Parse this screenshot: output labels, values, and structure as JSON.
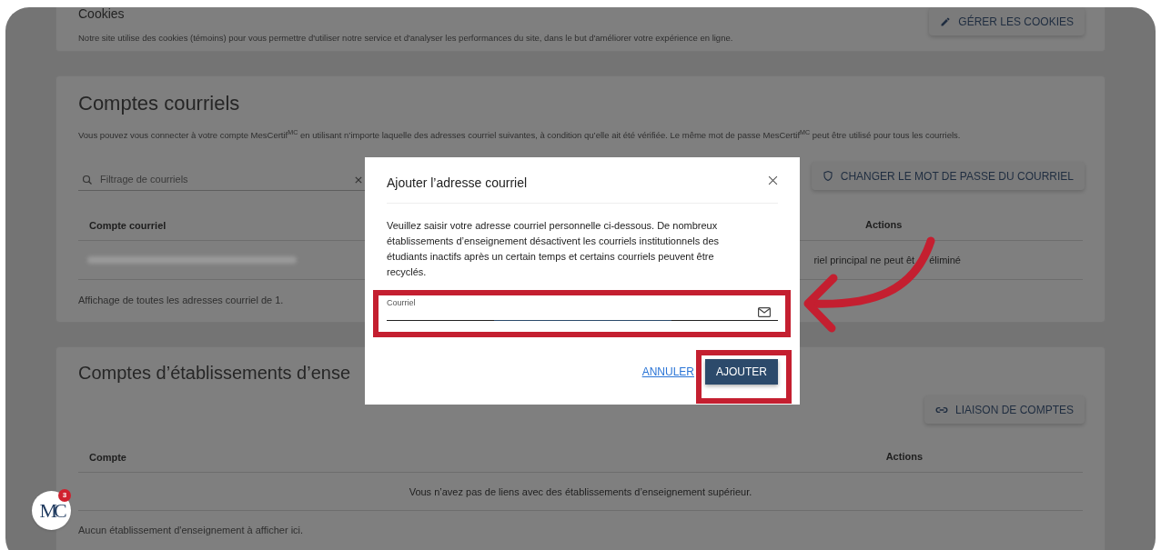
{
  "cookies": {
    "title": "Cookies",
    "description": "Notre site utilise des cookies (témoins) pour vous permettre d'utiliser notre service et d'analyser les performances du site, dans le but d'améliorer votre expérience en ligne.",
    "button": "GÉRER LES COOKIES"
  },
  "email_accounts": {
    "title": "Comptes courriels",
    "description": "Vous pouvez vous connecter à votre compte MesCertif$^{MC}$ en utilisant n’importe laquelle des adresses courriel suivantes, à condition qu’elle ait été vérifiée. Le même mot de passe MesCertif$^{MC}$ peut être utilisé pour tous les courriels.",
    "filter": {
      "placeholder": "Filtrage de courriels"
    },
    "button": "CHANGER LE MOT DE PASSE DU COURRIEL",
    "table": {
      "columns": [
        "Compte courriel",
        "Actions"
      ],
      "rows": [
        {
          "action_note": [
            "riel principal ne peut êt",
            "éliminé"
          ]
        }
      ]
    },
    "footer": "Affichage de toutes les adresses courriel de 1."
  },
  "institution_accounts": {
    "title": "Comptes d’établissements d’ense",
    "button": "LIAISON DE COMPTES",
    "table": {
      "columns": [
        "Compte",
        "Actions"
      ],
      "empty_message": "Vous n’avez pas de liens avec des établissements d’enseignement supérieur."
    },
    "footer": "Aucun établissement d'enseignement à afficher ici."
  },
  "dialog": {
    "title": "Ajouter l’adresse courriel",
    "message": "Veuillez saisir votre adresse courriel personnelle ci-dessous. De nombreux établissements d’enseignement désactivent les courriels institutionnels des étudiants inactifs après un certain temps et certains courriels peuvent être recyclés.",
    "field": {
      "label": "Courriel"
    },
    "buttons": [
      {
        "label": "ANNULER",
        "kind": "link"
      },
      {
        "label": "AJOUTER",
        "kind": "primary"
      }
    ]
  },
  "logo": {
    "text": "MC",
    "badge": "3"
  }
}
